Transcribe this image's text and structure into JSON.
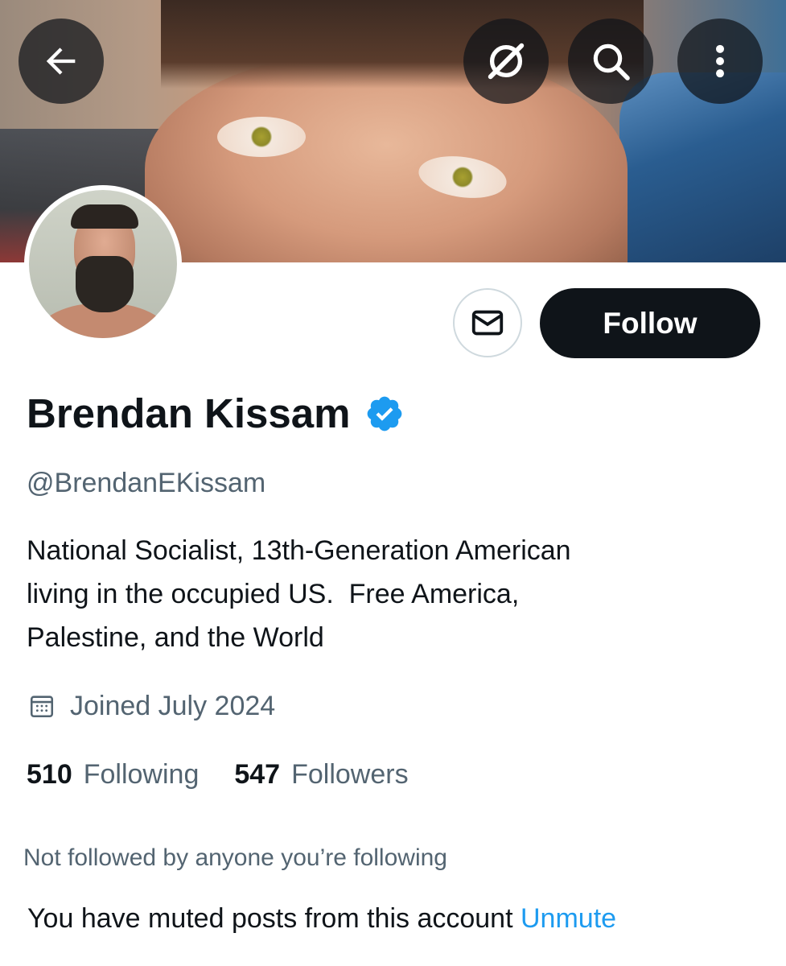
{
  "header": {
    "back_icon": "arrow-left-icon",
    "grok_icon": "grok-icon",
    "search_icon": "search-icon",
    "more_icon": "more-vertical-icon"
  },
  "profile": {
    "name": "Brendan Kissam",
    "verified": true,
    "verified_color": "#1d9bf0",
    "handle": "@BrendanEKissam",
    "bio_lines": [
      "National Socialist, 13th-Generation American",
      "living in the occupied US.  Free America,",
      "Palestine, and the World"
    ],
    "joined": "Joined July 2024"
  },
  "actions": {
    "message_icon": "envelope-icon",
    "follow_label": "Follow"
  },
  "stats": {
    "following_count": "510",
    "following_label": "Following",
    "followers_count": "547",
    "followers_label": "Followers"
  },
  "notices": {
    "not_followed": "Not followed by anyone you’re following",
    "muted": "You have muted posts from this account",
    "unmute_label": "Unmute"
  },
  "colors": {
    "text_primary": "#0f1419",
    "text_secondary": "#536471",
    "link": "#1d9bf0",
    "follow_button_bg": "#0f1419"
  }
}
